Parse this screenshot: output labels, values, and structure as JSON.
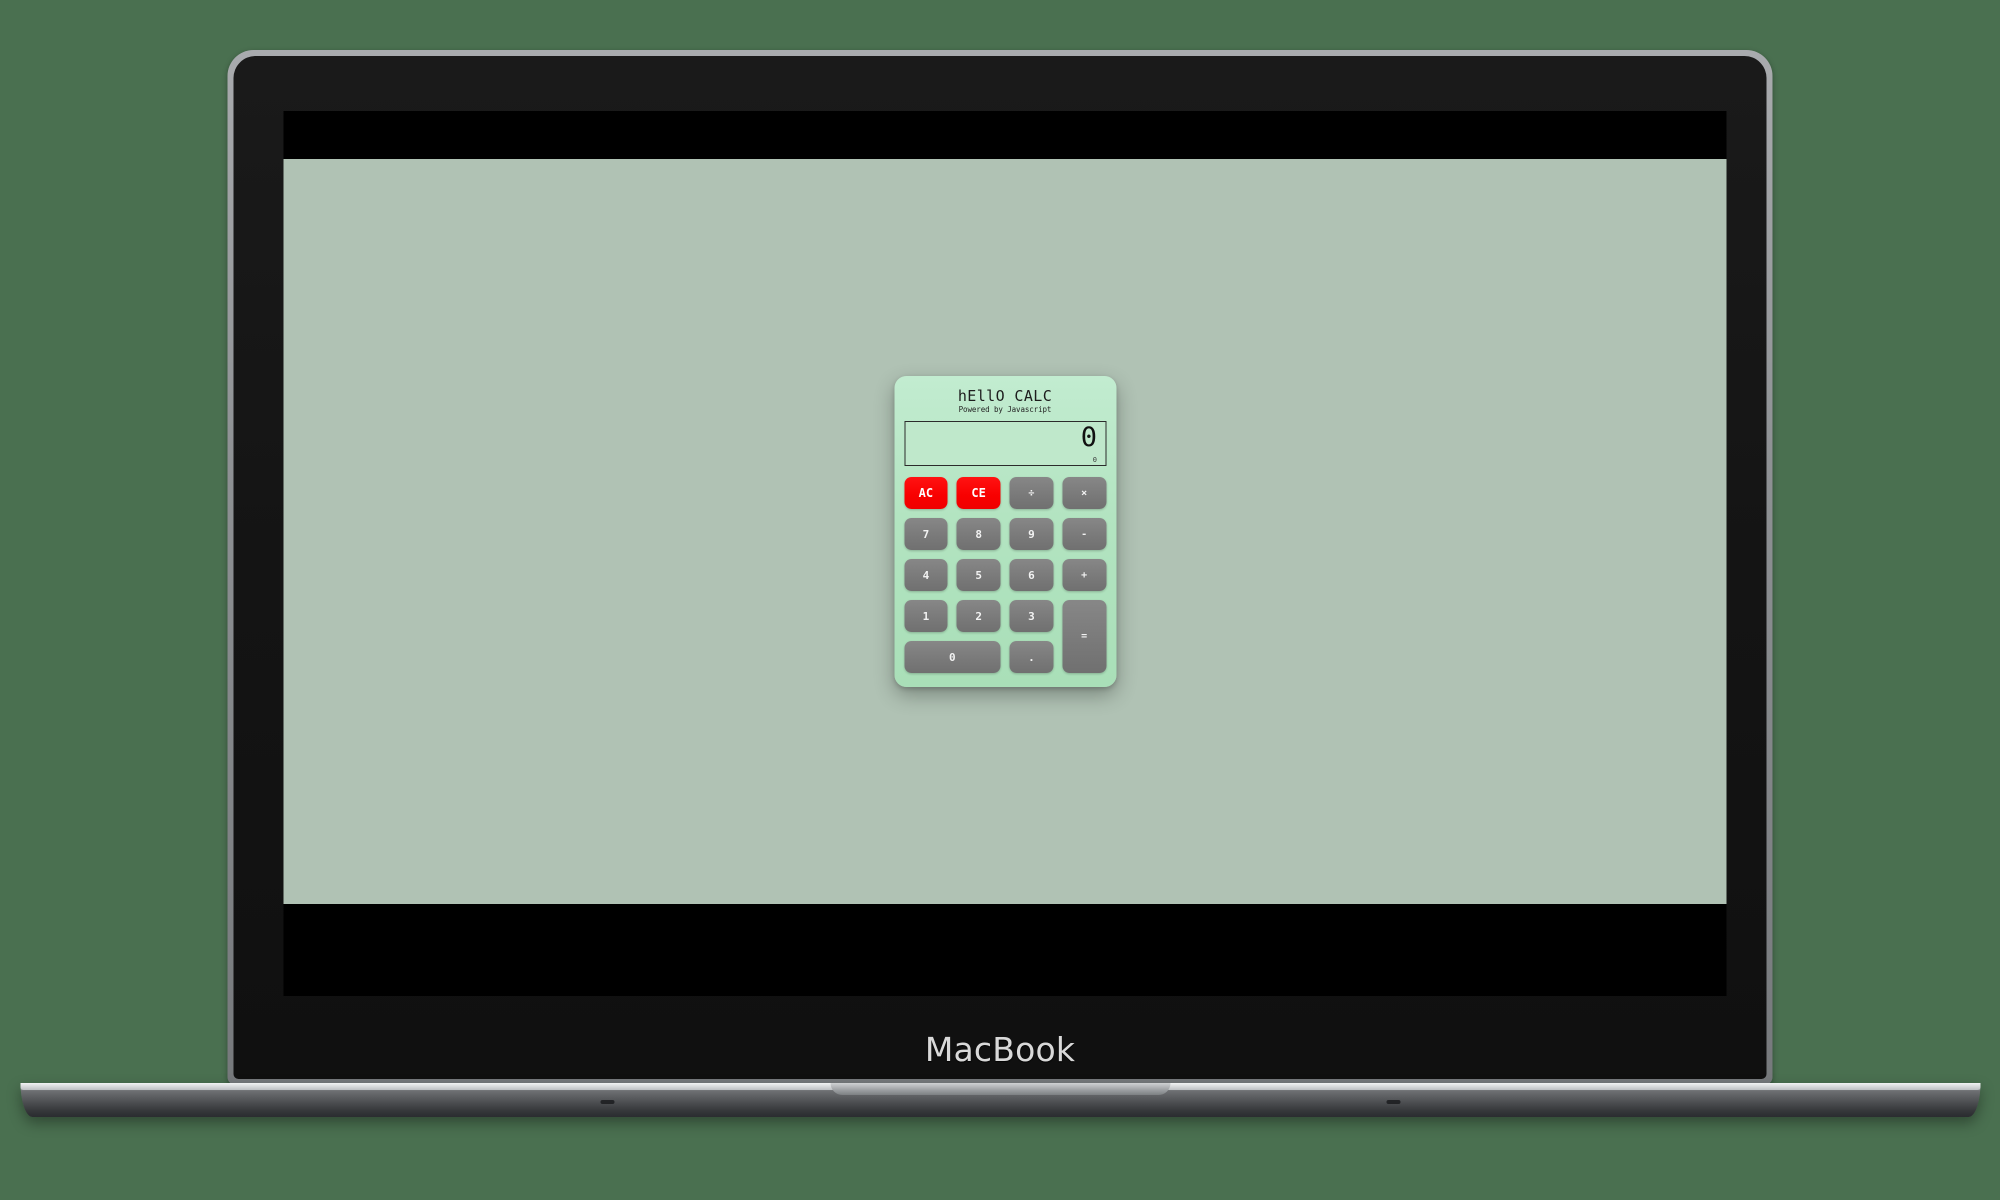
{
  "device": {
    "label": "MacBook",
    "brand_color": "#8e9194",
    "bezel_color": "#121212"
  },
  "desktop": {
    "background_color": "#b0c2b4",
    "page_background_color": "#4a7050"
  },
  "app": {
    "title": "hEllO CALC",
    "subtitle": "Powered by Javascript",
    "body_color": "#b3e4c1",
    "display": {
      "value": "0",
      "secondary_value": "0"
    },
    "colors": {
      "clear_key": "#f80000",
      "key": "#7a7a7a",
      "key_text": "#f2f2f2"
    },
    "keys": [
      {
        "label": "AC",
        "name": "key-all-clear",
        "kind": "clear"
      },
      {
        "label": "CE",
        "name": "key-clear-entry",
        "kind": "clear"
      },
      {
        "label": "÷",
        "name": "key-divide",
        "kind": "op"
      },
      {
        "label": "×",
        "name": "key-multiply",
        "kind": "op"
      },
      {
        "label": "7",
        "name": "key-7",
        "kind": "num"
      },
      {
        "label": "8",
        "name": "key-8",
        "kind": "num"
      },
      {
        "label": "9",
        "name": "key-9",
        "kind": "num"
      },
      {
        "label": "-",
        "name": "key-subtract",
        "kind": "op"
      },
      {
        "label": "4",
        "name": "key-4",
        "kind": "num"
      },
      {
        "label": "5",
        "name": "key-5",
        "kind": "num"
      },
      {
        "label": "6",
        "name": "key-6",
        "kind": "num"
      },
      {
        "label": "+",
        "name": "key-add",
        "kind": "op"
      },
      {
        "label": "1",
        "name": "key-1",
        "kind": "num"
      },
      {
        "label": "2",
        "name": "key-2",
        "kind": "num"
      },
      {
        "label": "3",
        "name": "key-3",
        "kind": "num"
      },
      {
        "label": "=",
        "name": "key-equals",
        "kind": "equals"
      },
      {
        "label": "0",
        "name": "key-0",
        "kind": "zero"
      },
      {
        "label": ".",
        "name": "key-decimal",
        "kind": "num"
      }
    ]
  }
}
